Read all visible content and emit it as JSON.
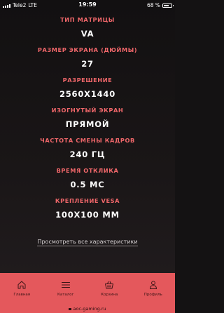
{
  "status_bar": {
    "carrier": "Tele2",
    "network": "LTE",
    "time": "19:59",
    "battery_percent": "68 %",
    "battery_level": 0.68
  },
  "specs": [
    {
      "label": "ТИП МАТРИЦЫ",
      "value": "VA"
    },
    {
      "label": "РАЗМЕР ЭКРАНА (ДЮЙМЫ)",
      "value": "27"
    },
    {
      "label": "РАЗРЕШЕНИЕ",
      "value": "2560X1440"
    },
    {
      "label": "ИЗОГНУТЫЙ ЭКРАН",
      "value": "ПРЯМОЙ"
    },
    {
      "label": "ЧАСТОТА СМЕНЫ КАДРОВ",
      "value": "240 ГЦ"
    },
    {
      "label": "ВРЕМЯ ОТКЛИКА",
      "value": "0.5 МС"
    },
    {
      "label": "КРЕПЛЕНИЕ VESA",
      "value": "100X100 ММ"
    }
  ],
  "all_specs_link": "Просмотреть все характеристики",
  "tabbar": {
    "items": [
      {
        "label": "Главная",
        "icon": "home-icon"
      },
      {
        "label": "Каталог",
        "icon": "menu-icon"
      },
      {
        "label": "Корзина",
        "icon": "basket-icon"
      },
      {
        "label": "Профиль",
        "icon": "user-icon"
      }
    ]
  },
  "url": "aoc-gaming.ru",
  "colors": {
    "accent": "#e4585c",
    "label": "#f0676a",
    "background": "#141213"
  }
}
